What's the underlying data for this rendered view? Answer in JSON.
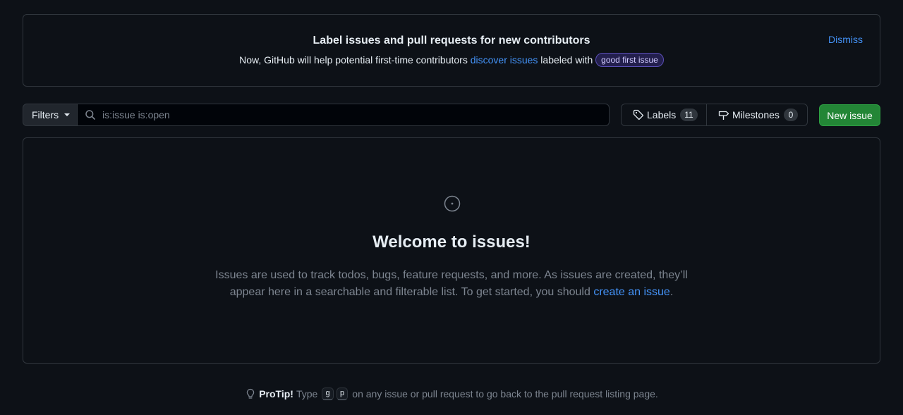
{
  "banner": {
    "title": "Label issues and pull requests for new contributors",
    "text_before": "Now, GitHub will help potential first-time contributors ",
    "link_text": "discover issues",
    "text_after": " labeled with ",
    "label_name": "good first issue",
    "dismiss": "Dismiss"
  },
  "toolbar": {
    "filters_label": "Filters",
    "search_value": "is:issue is:open",
    "labels_label": "Labels",
    "labels_count": "11",
    "milestones_label": "Milestones",
    "milestones_count": "0",
    "new_issue_label": "New issue"
  },
  "blankslate": {
    "title": "Welcome to issues!",
    "desc_before": "Issues are used to track todos, bugs, feature requests, and more. As issues are created, they’ll appear here in a searchable and filterable list. To get started, you should ",
    "link_text": "create an issue",
    "desc_after": "."
  },
  "protip": {
    "label": "ProTip!",
    "text_before": "Type",
    "key1": "g",
    "key2": "p",
    "text_after": "on any issue or pull request to go back to the pull request listing page."
  },
  "colors": {
    "background": "#0d1117",
    "link": "#4493f8",
    "primary_button": "#238636",
    "border": "#30363d"
  },
  "icons": {
    "search": "search-icon",
    "tag": "tag-icon",
    "milestone": "milestone-icon",
    "issue_opened": "issue-opened-icon",
    "light_bulb": "light-bulb-icon"
  }
}
